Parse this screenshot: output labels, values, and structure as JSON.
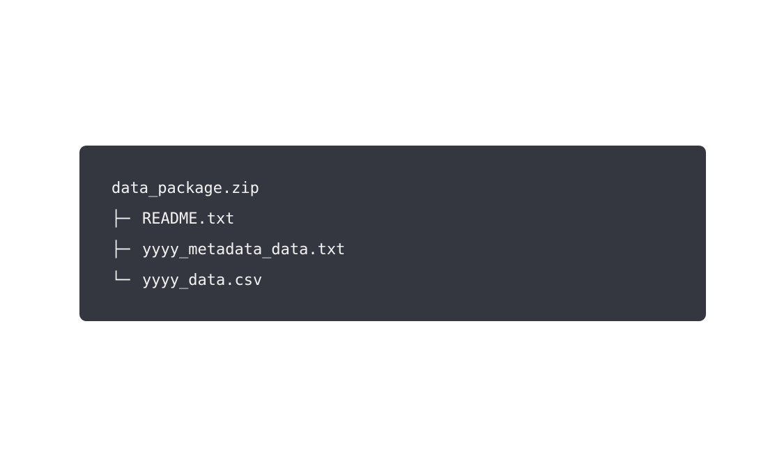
{
  "code_block": {
    "root": "data_package.zip",
    "entries": [
      {
        "branch": "├─",
        "name": "README.txt"
      },
      {
        "branch": "├─",
        "name": "yyyy_metadata_data.txt"
      },
      {
        "branch": "└─",
        "name": "yyyy_data.csv"
      }
    ],
    "colors": {
      "background": "#343740",
      "text": "#f2f2f2"
    }
  }
}
